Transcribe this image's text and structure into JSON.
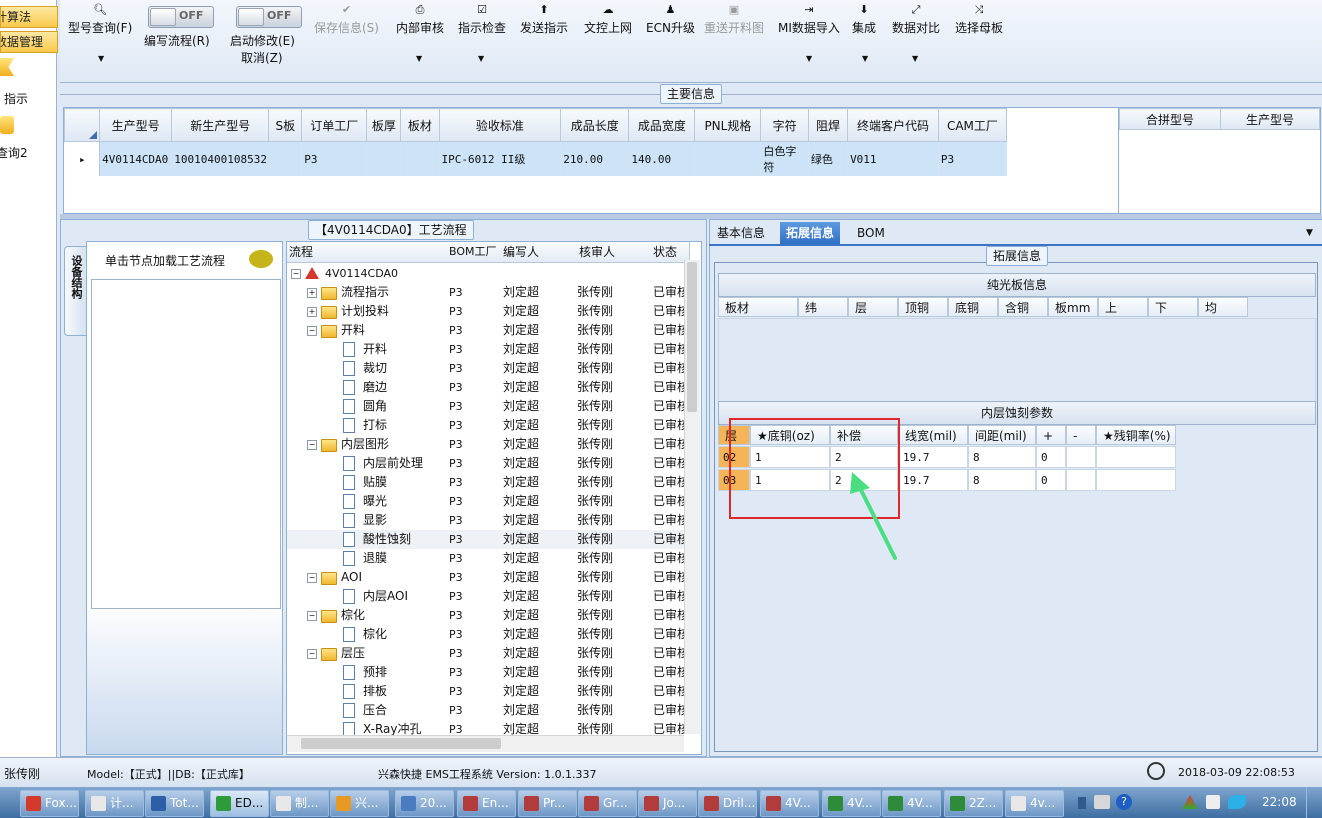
{
  "left_nav": {
    "btn1": "计算法",
    "btn2": "数据管理",
    "link1": "指示",
    "link2": "查询2"
  },
  "toolbar": {
    "items": [
      {
        "label": "型号查询(F)",
        "icon": "magnifier-icon"
      },
      {
        "label": "编写流程(R)",
        "toggle": "OFF"
      },
      {
        "label": "启动修改(E)",
        "label2": "取消(Z)",
        "toggle": "OFF"
      },
      {
        "label": "保存信息(S)",
        "icon": "check-icon",
        "disabled": true
      },
      {
        "label": "内部审核",
        "icon": "printer-icon"
      },
      {
        "label": "指示检查",
        "icon": "checkbox-icon"
      },
      {
        "label": "发送指示",
        "icon": "upload-icon"
      },
      {
        "label": "文控上网",
        "icon": "cloud-upload-icon"
      },
      {
        "label": "ECN升级",
        "icon": "person-icon"
      },
      {
        "label": "重送开料图",
        "icon": "image-icon",
        "disabled": true
      },
      {
        "label": "MI数据导入",
        "icon": "import-icon"
      },
      {
        "label": "集成",
        "icon": "download-icon"
      },
      {
        "label": "数据对比",
        "icon": "compare-icon"
      },
      {
        "label": "选择母板",
        "icon": "shuffle-icon"
      }
    ]
  },
  "main_info": {
    "title": "主要信息",
    "columns": [
      "生产型号",
      "新生产型号",
      "S板",
      "订单工厂",
      "板厚",
      "板材",
      "验收标准",
      "成品长度",
      "成品宽度",
      "PNL规格",
      "字符",
      "阻焊",
      "终端客户代码",
      "CAM工厂"
    ],
    "row": [
      "4V0114CDA0",
      "10010400108532",
      "",
      "P3",
      "",
      "",
      "IPC-6012 II级",
      "210.00",
      "140.00",
      "",
      "白色字符",
      "绿色",
      "V011",
      "P3"
    ],
    "side_columns": [
      "合拼型号",
      "生产型号"
    ]
  },
  "process": {
    "title": "【4V0114CDA0】工艺流程",
    "vertical_tab": "设备结构",
    "hint": "单击节点加载工艺流程",
    "columns": [
      "流程",
      "BOM工厂",
      "编写人",
      "核审人",
      "状态"
    ],
    "rows": [
      {
        "name": "4V0114CDA0",
        "level": 0,
        "type": "root",
        "bom": "",
        "writer": "",
        "checker": "",
        "status": ""
      },
      {
        "name": "流程指示",
        "level": 1,
        "type": "folder",
        "collapsed": true,
        "bom": "P3",
        "writer": "刘定超",
        "checker": "张传刚",
        "status": "已审核"
      },
      {
        "name": "计划投料",
        "level": 1,
        "type": "folder",
        "collapsed": true,
        "bom": "P3",
        "writer": "刘定超",
        "checker": "张传刚",
        "status": "已审核"
      },
      {
        "name": "开料",
        "level": 1,
        "type": "folder",
        "bom": "P3",
        "writer": "刘定超",
        "checker": "张传刚",
        "status": "已审核"
      },
      {
        "name": "开料",
        "level": 2,
        "type": "doc",
        "bom": "P3",
        "writer": "刘定超",
        "checker": "张传刚",
        "status": "已审核"
      },
      {
        "name": "裁切",
        "level": 2,
        "type": "doc",
        "bom": "P3",
        "writer": "刘定超",
        "checker": "张传刚",
        "status": "已审核"
      },
      {
        "name": "磨边",
        "level": 2,
        "type": "doc",
        "bom": "P3",
        "writer": "刘定超",
        "checker": "张传刚",
        "status": "已审核"
      },
      {
        "name": "圆角",
        "level": 2,
        "type": "doc",
        "bom": "P3",
        "writer": "刘定超",
        "checker": "张传刚",
        "status": "已审核"
      },
      {
        "name": "打标",
        "level": 2,
        "type": "doc",
        "bom": "P3",
        "writer": "刘定超",
        "checker": "张传刚",
        "status": "已审核"
      },
      {
        "name": "内层图形",
        "level": 1,
        "type": "folder",
        "bom": "P3",
        "writer": "刘定超",
        "checker": "张传刚",
        "status": "已审核"
      },
      {
        "name": "内层前处理",
        "level": 2,
        "type": "doc",
        "bom": "P3",
        "writer": "刘定超",
        "checker": "张传刚",
        "status": "已审核"
      },
      {
        "name": "贴膜",
        "level": 2,
        "type": "doc",
        "bom": "P3",
        "writer": "刘定超",
        "checker": "张传刚",
        "status": "已审核"
      },
      {
        "name": "曝光",
        "level": 2,
        "type": "doc",
        "bom": "P3",
        "writer": "刘定超",
        "checker": "张传刚",
        "status": "已审核"
      },
      {
        "name": "显影",
        "level": 2,
        "type": "doc",
        "bom": "P3",
        "writer": "刘定超",
        "checker": "张传刚",
        "status": "已审核"
      },
      {
        "name": "酸性蚀刻",
        "level": 2,
        "type": "doc",
        "selected": true,
        "bom": "P3",
        "writer": "刘定超",
        "checker": "张传刚",
        "status": "已审核"
      },
      {
        "name": "退膜",
        "level": 2,
        "type": "doc",
        "bom": "P3",
        "writer": "刘定超",
        "checker": "张传刚",
        "status": "已审核"
      },
      {
        "name": "AOI",
        "level": 1,
        "type": "folder",
        "bom": "P3",
        "writer": "刘定超",
        "checker": "张传刚",
        "status": "已审核"
      },
      {
        "name": "内层AOI",
        "level": 2,
        "type": "doc",
        "bom": "P3",
        "writer": "刘定超",
        "checker": "张传刚",
        "status": "已审核"
      },
      {
        "name": "棕化",
        "level": 1,
        "type": "folder",
        "bom": "P3",
        "writer": "刘定超",
        "checker": "张传刚",
        "status": "已审核"
      },
      {
        "name": "棕化",
        "level": 2,
        "type": "doc",
        "bom": "P3",
        "writer": "刘定超",
        "checker": "张传刚",
        "status": "已审核"
      },
      {
        "name": "层压",
        "level": 1,
        "type": "folder",
        "bom": "P3",
        "writer": "刘定超",
        "checker": "张传刚",
        "status": "已审核"
      },
      {
        "name": "预排",
        "level": 2,
        "type": "doc",
        "bom": "P3",
        "writer": "刘定超",
        "checker": "张传刚",
        "status": "已审核"
      },
      {
        "name": "排板",
        "level": 2,
        "type": "doc",
        "bom": "P3",
        "writer": "刘定超",
        "checker": "张传刚",
        "status": "已审核"
      },
      {
        "name": "压合",
        "level": 2,
        "type": "doc",
        "bom": "P3",
        "writer": "刘定超",
        "checker": "张传刚",
        "status": "已审核"
      },
      {
        "name": "X-Ray冲孔",
        "level": 2,
        "type": "doc",
        "bom": "P3",
        "writer": "刘定超",
        "checker": "张传刚",
        "status": "已审核"
      }
    ]
  },
  "right_panel": {
    "tabs": [
      "基本信息",
      "拓展信息",
      "BOM"
    ],
    "active_tab": 1,
    "group_title": "拓展信息",
    "bare_board": {
      "title": "纯光板信息",
      "columns": [
        "板材",
        "纬",
        "层",
        "顶铜",
        "底铜",
        "含铜",
        "板mm",
        "上",
        "下",
        "均"
      ]
    },
    "etch": {
      "title": "内层蚀刻参数",
      "columns": [
        "层",
        "★底铜(oz)",
        "补偿",
        "线宽(mil)",
        "间距(mil)",
        "+",
        "-",
        "★残铜率(%)"
      ],
      "rows": [
        [
          "02",
          "1",
          "2",
          "19.7",
          "8",
          "0",
          "",
          ""
        ],
        [
          "03",
          "1",
          "2",
          "19.7",
          "8",
          "0",
          "",
          ""
        ]
      ]
    }
  },
  "status_bar": {
    "user": "张传刚",
    "model": "Model:【正式】||DB:【正式库】",
    "system": "兴森快捷 EMS工程系统 Version: 1.0.1.337",
    "datetime": "2018-03-09 22:08:53"
  },
  "taskbar": {
    "items": [
      {
        "label": "Fox...",
        "color": "#d33a2c"
      },
      {
        "label": "计...",
        "color": "#e8e8e8"
      },
      {
        "label": "Tot...",
        "color": "#2d5fa8"
      },
      {
        "label": "ED...",
        "color": "#2e9b3a",
        "active": true
      },
      {
        "label": "制...",
        "color": "#e8e8e8"
      },
      {
        "label": "兴...",
        "color": "#e79a23"
      },
      {
        "label": "20...",
        "color": "#4a7cc2"
      },
      {
        "label": "En...",
        "color": "#b23b3b"
      },
      {
        "label": "Pr...",
        "color": "#b23b3b"
      },
      {
        "label": "Gr...",
        "color": "#b23b3b"
      },
      {
        "label": "Jo...",
        "color": "#b23b3b"
      },
      {
        "label": "Dril...",
        "color": "#b23b3b"
      },
      {
        "label": "4V...",
        "color": "#b23b3b"
      },
      {
        "label": "4V...",
        "color": "#2e8b3a"
      },
      {
        "label": "4V...",
        "color": "#2e8b3a"
      },
      {
        "label": "2Z...",
        "color": "#2e8b3a"
      },
      {
        "label": "4v...",
        "color": "#e8e8e8"
      }
    ],
    "clock": "22:08"
  }
}
